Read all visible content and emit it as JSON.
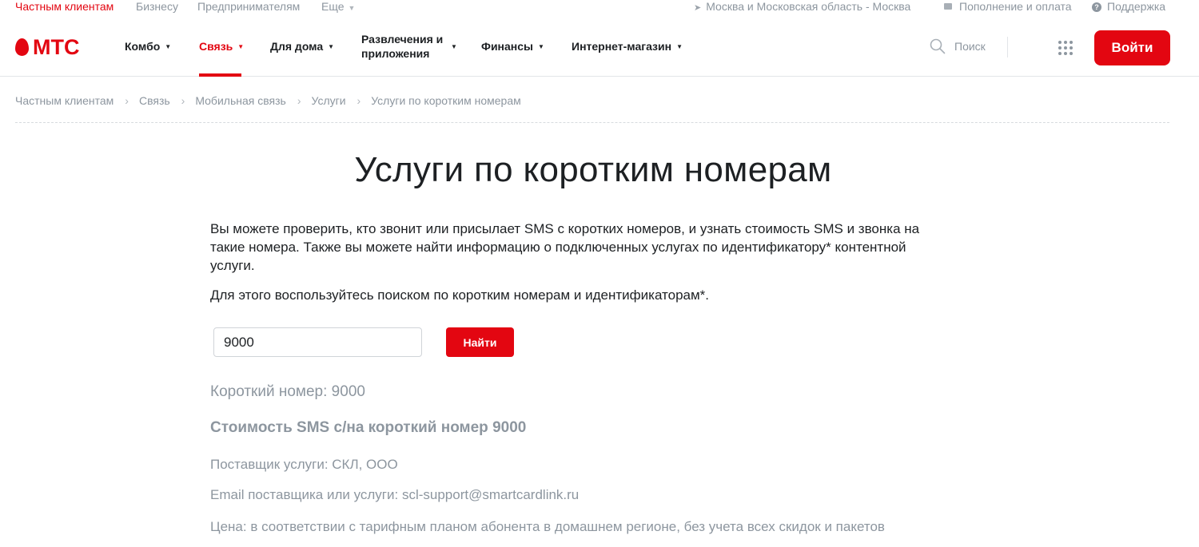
{
  "topbar": {
    "segments": [
      "Частным клиентам",
      "Бизнесу",
      "Предпринимателям",
      "Еще"
    ],
    "region": "Москва и Московская область - Москва",
    "topup": "Пополнение и оплата",
    "support": "Поддержка"
  },
  "header": {
    "logo": "МТС",
    "nav": [
      "Комбо",
      "Связь",
      "Для дома",
      "Развлечения и приложения",
      "Финансы",
      "Интернет-магазин"
    ],
    "search_label": "Поиск",
    "login": "Войти"
  },
  "breadcrumbs": [
    "Частным клиентам",
    "Связь",
    "Мобильная связь",
    "Услуги",
    "Услуги по коротким номерам"
  ],
  "page": {
    "title": "Услуги по коротким номерам",
    "intro1": "Вы можете проверить, кто звонит или присылает SMS с коротких номеров, и узнать стоимость SMS и звонка на такие номера. Также вы можете найти информацию о подключенных услугах по идентификатору* контентной услуги.",
    "intro2": "Для этого воспользуйтесь поиском по коротким номерам и идентификаторам*.",
    "search_value": "9000",
    "find_button": "Найти"
  },
  "result": {
    "short_number": "Короткий номер: 9000",
    "sms_cost_heading": "Стоимость SMS с/на короткий номер 9000",
    "provider": "Поставщик услуги: СКЛ, ООО",
    "email": "Email поставщика или услуги: scl-support@smartcardlink.ru",
    "price": "Цена: в соответствии с тарифным планом абонента в домашнем регионе, без учета всех скидок и пакетов"
  },
  "colors": {
    "accent": "#e30611",
    "muted": "#8d969f",
    "text": "#1d2023"
  },
  "icons": [
    "location-arrow-icon",
    "card-icon",
    "help-icon",
    "search-icon",
    "apps-grid-icon",
    "mts-egg-logo"
  ]
}
